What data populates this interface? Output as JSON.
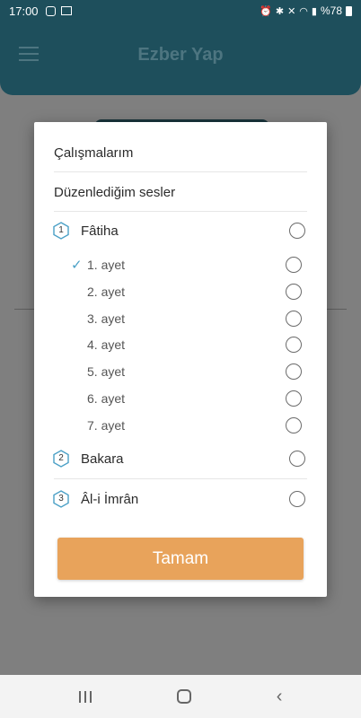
{
  "status_bar": {
    "time": "17:00",
    "battery_text": "%78"
  },
  "app_bar": {
    "title": "Ezber Yap"
  },
  "dialog": {
    "menu": [
      "Çalışmalarım",
      "Düzenlediğim sesler"
    ],
    "surahs": [
      {
        "number": "1",
        "name": "Fâtiha",
        "ayahs": [
          {
            "label": "1. ayet",
            "checked": true
          },
          {
            "label": "2. ayet",
            "checked": false
          },
          {
            "label": "3. ayet",
            "checked": false
          },
          {
            "label": "4. ayet",
            "checked": false
          },
          {
            "label": "5. ayet",
            "checked": false
          },
          {
            "label": "6. ayet",
            "checked": false
          },
          {
            "label": "7. ayet",
            "checked": false
          }
        ]
      },
      {
        "number": "2",
        "name": "Bakara"
      },
      {
        "number": "3",
        "name": "Âl-i İmrân"
      }
    ],
    "ok_button": "Tamam"
  },
  "colors": {
    "app_bar": "#1e4f5c",
    "accent_button": "#e8a35b",
    "check": "#4aa0c6"
  },
  "icons": [
    "alarm-icon",
    "bluetooth-icon",
    "mute-icon",
    "wifi-icon",
    "signal-icon",
    "battery-icon",
    "hamburger-menu-icon",
    "hexagon-icon",
    "check-icon",
    "recents-icon",
    "home-icon",
    "back-icon"
  ]
}
